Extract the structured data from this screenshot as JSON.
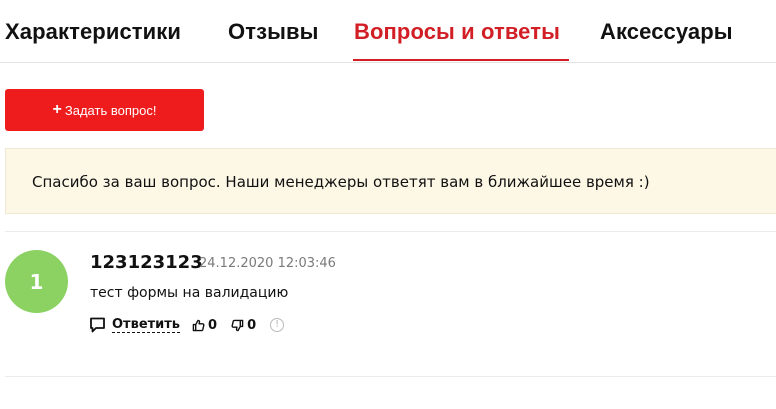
{
  "tabs": [
    {
      "label": "Характеристики",
      "active": false
    },
    {
      "label": "Отзывы",
      "active": false
    },
    {
      "label": "Вопросы и ответы",
      "active": true
    },
    {
      "label": "Аксессуары",
      "active": false
    }
  ],
  "ask_button": {
    "label": "Задать вопрос!",
    "icon": "plus-icon"
  },
  "notice": {
    "text": "Спасибо за ваш вопрос. Наши менеджеры ответят вам в ближайшее время :)"
  },
  "question": {
    "avatar_initial": "1",
    "author": "123123123",
    "date": "24.12.2020 12:03:46",
    "text": "тест формы на валидацию",
    "reply_label": "Ответить",
    "likes": "0",
    "dislikes": "0"
  },
  "colors": {
    "accent": "#d21f26",
    "button": "#ee1c1c",
    "notice_bg": "#fdf8e6",
    "avatar_bg": "#8cd262"
  }
}
